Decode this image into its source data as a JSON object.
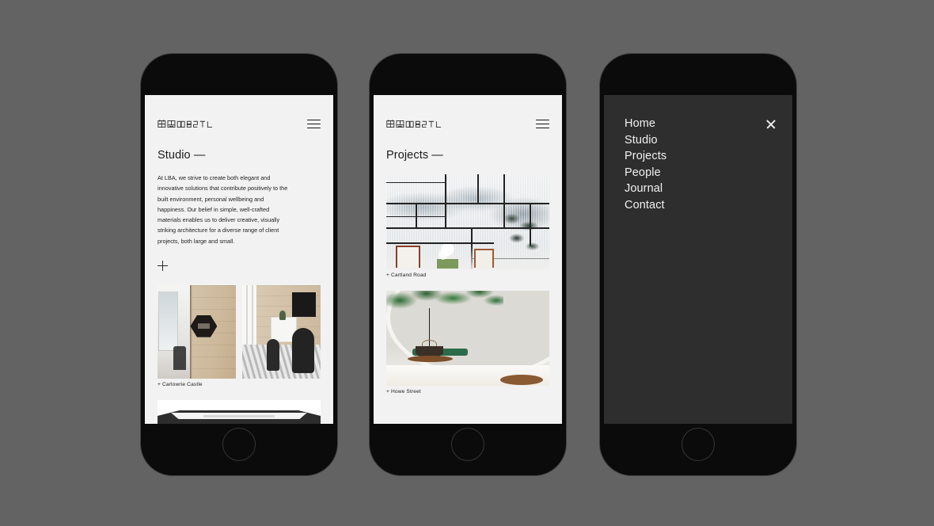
{
  "background_color": "#636363",
  "brand": {
    "logo_text": "LBA",
    "logo_style": "geometric-wordmark"
  },
  "phones": [
    {
      "id": "phone-studio",
      "screen_bg": "#f2f2f2",
      "header": {
        "logo_alt": "LBA logo",
        "menu_icon": "hamburger-icon"
      },
      "page_title": "Studio —",
      "intro_text": "At LBA, we strive to create both elegant and innovative solutions that contribute positively to the built environment, personal wellbeing and happiness. Our belief in simple, well-crafted materials enables us to deliver creative, visually striking architecture for a diverse range of client projects, both large and small.",
      "expand_icon": "plus-icon",
      "projects": [
        {
          "caption": "+ Carlowrie Castle",
          "image_alt": "office corridor with timber wall and hexagonal sign"
        }
      ]
    },
    {
      "id": "phone-projects",
      "screen_bg": "#f2f2f2",
      "header": {
        "logo_alt": "LBA logo",
        "menu_icon": "hamburger-icon"
      },
      "page_title": "Projects —",
      "projects": [
        {
          "caption": "+ Cartland Road",
          "image_alt": "interior with gridded screens and mountain mural"
        },
        {
          "caption": "+ Howe Street",
          "image_alt": "tea room with arch, greenery and wooden table"
        }
      ]
    },
    {
      "id": "phone-menu",
      "screen_bg": "#2e2e2e",
      "close_icon": "close-icon",
      "menu_items": [
        "Home",
        "Studio",
        "Projects",
        "People",
        "Journal",
        "Contact"
      ]
    }
  ]
}
